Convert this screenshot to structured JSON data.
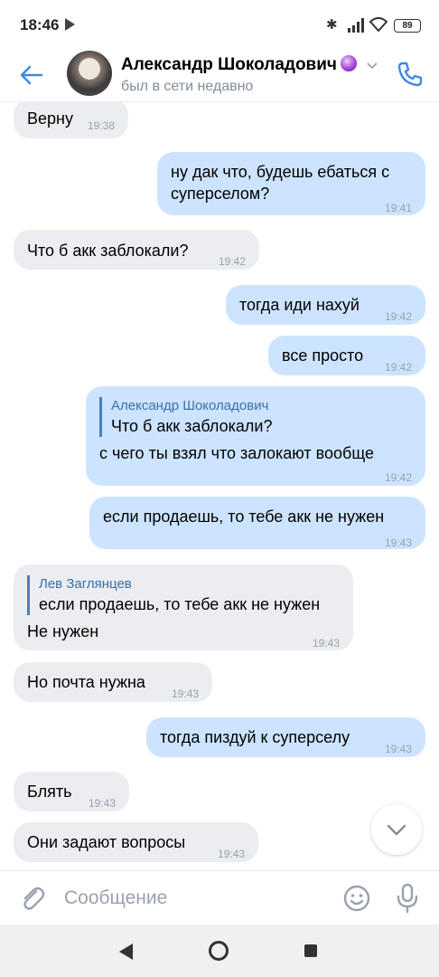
{
  "status_bar": {
    "time": "18:46",
    "battery": "89"
  },
  "header": {
    "name": "Александр Шоколадович",
    "status": "был в сети недавно"
  },
  "messages": [
    {
      "dir": "in",
      "text": "Верну",
      "time": "19:38"
    },
    {
      "dir": "out",
      "text": "ну дак что, будешь ебаться с суперселом?",
      "time": "19:41"
    },
    {
      "dir": "in",
      "text": "Что б акк заблокали?",
      "time": "19:42"
    },
    {
      "dir": "out",
      "text": "тогда иди нахуй",
      "time": "19:42"
    },
    {
      "dir": "out",
      "text": "все просто",
      "time": "19:42"
    },
    {
      "dir": "out",
      "reply_author": "Александр Шоколадович",
      "reply_text": "Что б акк заблокали?",
      "text": "с чего ты взял что залокают вообще",
      "time": "19:42"
    },
    {
      "dir": "out",
      "text": "если продаешь, то тебе акк не нужен",
      "time": "19:43"
    },
    {
      "dir": "in",
      "reply_author": "Лев Заглянцев",
      "reply_text": "если продаешь, то тебе акк не нужен",
      "text": "Не нужен",
      "time": "19:43"
    },
    {
      "dir": "in",
      "text": "Но почта нужна",
      "time": "19:43"
    },
    {
      "dir": "out",
      "text": "тогда пиздуй к суперселу",
      "time": "19:43"
    },
    {
      "dir": "in",
      "text": "Блять",
      "time": "19:43"
    },
    {
      "dir": "in",
      "text": "Они задают вопросы",
      "time": "19:43"
    }
  ],
  "composer": {
    "placeholder": "Сообщение"
  },
  "colors": {
    "accent": "#3f8ae0",
    "incoming": "#ebedf0",
    "outgoing": "#cce4ff"
  }
}
